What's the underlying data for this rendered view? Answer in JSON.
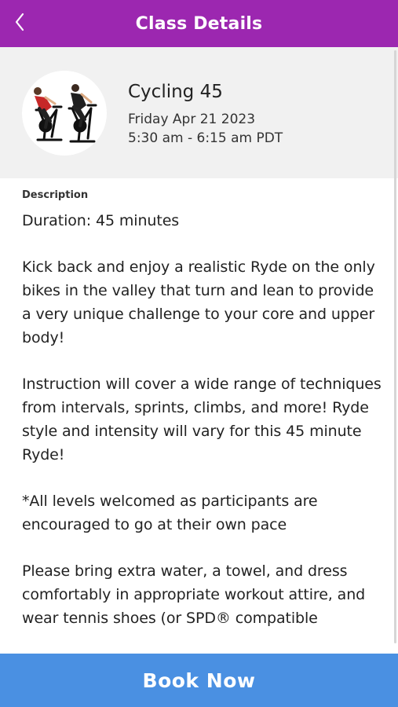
{
  "header": {
    "title": "Class Details",
    "back_icon": "chevron-left-icon"
  },
  "class": {
    "name": "Cycling 45",
    "date": "Friday Apr 21 2023",
    "time": "5:30 am - 6:15 am PDT",
    "image": "cyclists-illustration"
  },
  "description": {
    "label": "Description",
    "paragraphs": [
      "Duration: 45 minutes",
      "Kick back and enjoy a realistic Ryde on the only bikes in the valley that turn and lean to provide a very unique challenge to your core and upper body!",
      "Instruction will cover a wide range of techniques from intervals, sprints, climbs, and more! Ryde style and intensity will vary for this 45 minute Ryde!",
      "*All levels welcomed as participants are encouraged to go at their own pace",
      "Please bring extra water, a towel, and dress comfortably in appropriate workout attire, and wear tennis shoes (or SPD® compatible"
    ]
  },
  "actions": {
    "book_label": "Book Now"
  },
  "colors": {
    "header_bg": "#9c27b0",
    "button_bg": "#4a90e2",
    "card_bg": "#f1f1f1"
  }
}
